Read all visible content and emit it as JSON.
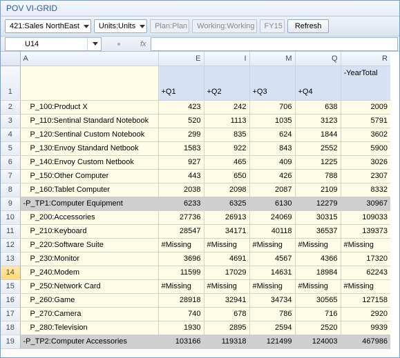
{
  "window": {
    "title": "POV VI-GRID"
  },
  "pov": {
    "entity": "421:Sales NorthEast",
    "units": "Units:Units",
    "plan": "Plan:Plan",
    "working": "Working:Working",
    "year": "FY15",
    "refresh": "Refresh"
  },
  "namebox": {
    "ref": "U14",
    "fx": "fx"
  },
  "columns": {
    "rowhdr": "",
    "A": "A",
    "E": "E",
    "I": "I",
    "M": "M",
    "Q": "Q",
    "R": "R"
  },
  "headers": {
    "row": "1",
    "A": "",
    "E": "+Q1",
    "I": "+Q2",
    "M": "+Q3",
    "Q": "+Q4",
    "R": "-YearTotal"
  },
  "rows": [
    {
      "n": "2",
      "A": "  P_100:Product X",
      "E": "423",
      "I": "242",
      "M": "706",
      "Q": "638",
      "R": "2009",
      "cls": ""
    },
    {
      "n": "3",
      "A": "  P_110:Sentinal Standard Notebook",
      "E": "520",
      "I": "1113",
      "M": "1035",
      "Q": "3123",
      "R": "5791",
      "cls": ""
    },
    {
      "n": "4",
      "A": "  P_120:Sentinal Custom Notebook",
      "E": "299",
      "I": "835",
      "M": "624",
      "Q": "1844",
      "R": "3602",
      "cls": ""
    },
    {
      "n": "5",
      "A": "  P_130:Envoy Standard Netbook",
      "E": "1583",
      "I": "922",
      "M": "843",
      "Q": "2552",
      "R": "5900",
      "cls": ""
    },
    {
      "n": "6",
      "A": "  P_140:Envoy Custom Netbook",
      "E": "927",
      "I": "465",
      "M": "409",
      "Q": "1225",
      "R": "3026",
      "cls": ""
    },
    {
      "n": "7",
      "A": "  P_150:Other Computer",
      "E": "443",
      "I": "650",
      "M": "426",
      "Q": "788",
      "R": "2307",
      "cls": ""
    },
    {
      "n": "8",
      "A": "  P_160:Tablet Computer",
      "E": "2038",
      "I": "2098",
      "M": "2087",
      "Q": "2109",
      "R": "8332",
      "cls": ""
    },
    {
      "n": "9",
      "A": "-P_TP1:Computer Equipment",
      "E": "6233",
      "I": "6325",
      "M": "6130",
      "Q": "12279",
      "R": "30967",
      "cls": "subtotal"
    },
    {
      "n": "10",
      "A": "  P_200:Accessories",
      "E": "27736",
      "I": "26913",
      "M": "24069",
      "Q": "30315",
      "R": "109033",
      "cls": ""
    },
    {
      "n": "11",
      "A": "  P_210:Keyboard",
      "E": "28547",
      "I": "34171",
      "M": "40118",
      "Q": "36537",
      "R": "139373",
      "cls": ""
    },
    {
      "n": "12",
      "A": "  P_220:Software Suite",
      "E": "#Missing",
      "I": "#Missing",
      "M": "#Missing",
      "Q": "#Missing",
      "R": "#Missing",
      "cls": "miss"
    },
    {
      "n": "13",
      "A": "  P_230:Monitor",
      "E": "3696",
      "I": "4691",
      "M": "4567",
      "Q": "4366",
      "R": "17320",
      "cls": ""
    },
    {
      "n": "14",
      "A": "  P_240:Modem",
      "E": "11599",
      "I": "17029",
      "M": "14631",
      "Q": "18984",
      "R": "62243",
      "cls": "",
      "sel": true
    },
    {
      "n": "15",
      "A": "  P_250:Network Card",
      "E": "#Missing",
      "I": "#Missing",
      "M": "#Missing",
      "Q": "#Missing",
      "R": "#Missing",
      "cls": "miss"
    },
    {
      "n": "16",
      "A": "  P_260:Game",
      "E": "28918",
      "I": "32941",
      "M": "34734",
      "Q": "30565",
      "R": "127158",
      "cls": ""
    },
    {
      "n": "17",
      "A": "  P_270:Camera",
      "E": "740",
      "I": "678",
      "M": "786",
      "Q": "716",
      "R": "2920",
      "cls": ""
    },
    {
      "n": "18",
      "A": "  P_280:Television",
      "E": "1930",
      "I": "2895",
      "M": "2594",
      "Q": "2520",
      "R": "9939",
      "cls": ""
    },
    {
      "n": "19",
      "A": "-P_TP2:Computer Accessories",
      "E": "103166",
      "I": "119318",
      "M": "121499",
      "Q": "124003",
      "R": "467986",
      "cls": "subtotal"
    }
  ]
}
